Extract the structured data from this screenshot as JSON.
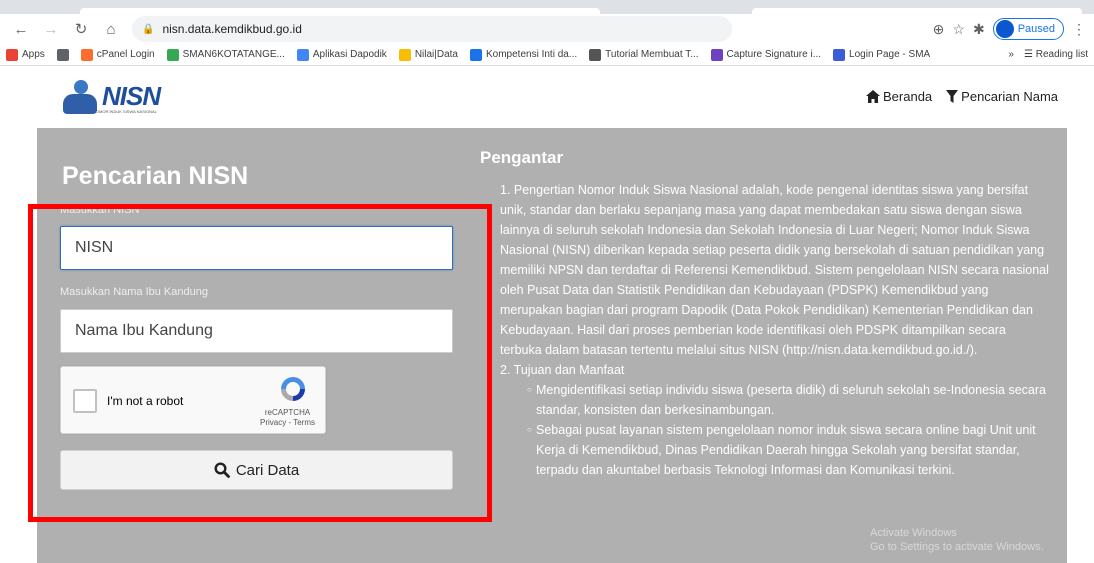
{
  "browser": {
    "url": "nisn.data.kemdikbud.go.id",
    "profile_status": "Paused",
    "bookmarks": [
      {
        "label": "Apps",
        "color": "#ea4335"
      },
      {
        "label": "",
        "color": "#5f6368"
      },
      {
        "label": "cPanel Login",
        "color": "#ff6c2c"
      },
      {
        "label": "SMAN6KOTATANGE...",
        "color": "#34a853"
      },
      {
        "label": "Aplikasi Dapodik",
        "color": "#4285f4"
      },
      {
        "label": "Nilai|Data",
        "color": "#fbbc05"
      },
      {
        "label": "Kompetensi Inti da...",
        "color": "#1a73e8"
      },
      {
        "label": "Tutorial Membuat T...",
        "color": "#555555"
      },
      {
        "label": "Capture Signature i...",
        "color": "#6f42c1"
      },
      {
        "label": "Login Page - SMA",
        "color": "#3b5bdb"
      }
    ],
    "more": "»",
    "reading_list": "Reading list"
  },
  "site": {
    "logo_text": "NISN",
    "logo_sub": "NOMOR INDUK SISWA NASIONAL",
    "nav": [
      {
        "label": "Beranda",
        "icon": "home-icon"
      },
      {
        "label": "Pencarian Nama",
        "icon": "filter-icon"
      }
    ]
  },
  "form": {
    "title": "Pencarian NISN",
    "nisn_label": "Masukkan NISN",
    "nisn_placeholder": "NISN",
    "mother_label": "Masukkan Nama Ibu Kandung",
    "mother_placeholder": "Nama Ibu Kandung",
    "captcha_label": "I'm not a robot",
    "captcha_brand": "reCAPTCHA",
    "captcha_links": "Privacy - Terms",
    "submit_label": "Cari Data"
  },
  "intro": {
    "title": "Pengantar",
    "item1": "1. Pengertian Nomor Induk Siswa Nasional adalah, kode pengenal identitas siswa yang bersifat unik, standar dan berlaku sepanjang masa yang dapat membedakan satu siswa dengan siswa lainnya di seluruh sekolah Indonesia dan Sekolah Indonesia di Luar Negeri; Nomor Induk Siswa Nasional (NISN) diberikan kepada setiap peserta didik yang bersekolah di satuan pendidikan yang memiliki NPSN dan terdaftar di Referensi Kemendikbud. Sistem pengelolaan NISN secara nasional oleh Pusat Data dan Statistik Pendidikan dan Kebudayaan (PDSPK) Kemendikbud yang merupakan bagian dari program Dapodik (Data Pokok Pendidikan) Kementerian Pendidikan dan Kebudayaan. Hasil dari proses pemberian kode identifikasi oleh PDSPK ditampilkan secara terbuka dalam batasan tertentu melalui situs NISN (http://nisn.data.kemdikbud.go.id./).",
    "item2": "2. Tujuan dan Manfaat",
    "sub1": "Mengidentifikasi setiap individu siswa (peserta didik) di seluruh sekolah se-Indonesia secara standar, konsisten dan berkesinambungan.",
    "sub2": "Sebagai pusat layanan sistem pengelolaan nomor induk siswa secara online bagi Unit unit Kerja di Kemendikbud, Dinas Pendidikan Daerah hingga Sekolah yang bersifat standar, terpadu dan akuntabel berbasis Teknologi Informasi dan Komunikasi terkini."
  },
  "watermark": {
    "line1": "Activate Windows",
    "line2": "Go to Settings to activate Windows."
  },
  "colors": {
    "band": "#b0b0b0",
    "highlight": "#ff0000",
    "logo": "#1e4f9a"
  }
}
